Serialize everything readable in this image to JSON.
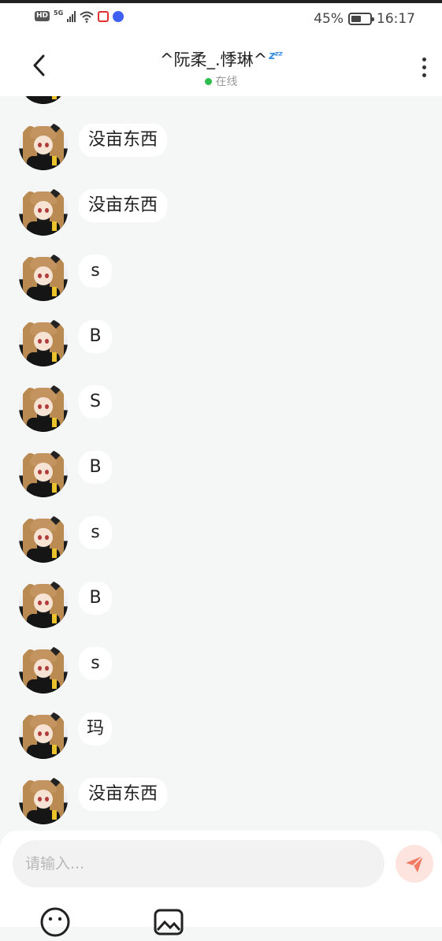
{
  "status_bar": {
    "hd": "HD",
    "network": "5G",
    "battery": "45%",
    "time": "16:17"
  },
  "header": {
    "title": "^阮柔_.悸琳^",
    "status_emoji": "zzz",
    "online_status": "在线"
  },
  "messages": [
    "没亩东西",
    "没亩东西",
    "s",
    "B",
    "S",
    "B",
    "s",
    "B",
    "s",
    "玛",
    "没亩东西"
  ],
  "input": {
    "placeholder": "请输入..."
  },
  "colors": {
    "chat_background": "#f5f7f6",
    "online_dot": "#2ebd4f",
    "send_button": "#f07a63",
    "bubble": "#ffffff"
  },
  "icons": {
    "back": "chevron-left-icon",
    "menu": "more-vertical-icon",
    "send": "paper-plane-icon",
    "emoji": "emoji-icon",
    "image": "image-icon"
  }
}
